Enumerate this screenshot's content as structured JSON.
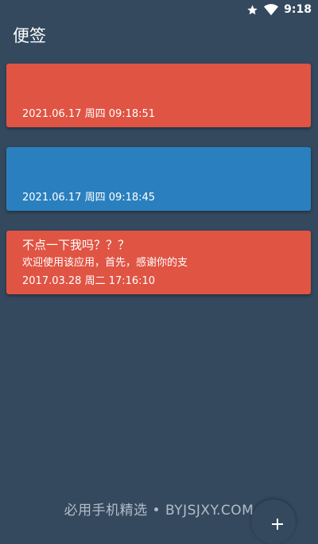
{
  "status_bar": {
    "time": "9:18",
    "icons": [
      "star-icon",
      "wifi-icon"
    ]
  },
  "app": {
    "title": "便签"
  },
  "notes": [
    {
      "title": "",
      "preview": "",
      "date": "2021.06.17 周四 09:18:51",
      "color": "#e05444"
    },
    {
      "title": "",
      "preview": "",
      "date": "2021.06.17 周四 09:18:45",
      "color": "#2a80be"
    },
    {
      "title": "不点一下我吗？？？",
      "preview": "欢迎使用该应用，首先，感谢你的支",
      "date": "2017.03.28 周二 17:16:10",
      "color": "#e05444"
    }
  ],
  "fab": {
    "icon": "plus-icon"
  },
  "watermark": {
    "text": "必用手机精选 • BYJSJXY.COM"
  }
}
